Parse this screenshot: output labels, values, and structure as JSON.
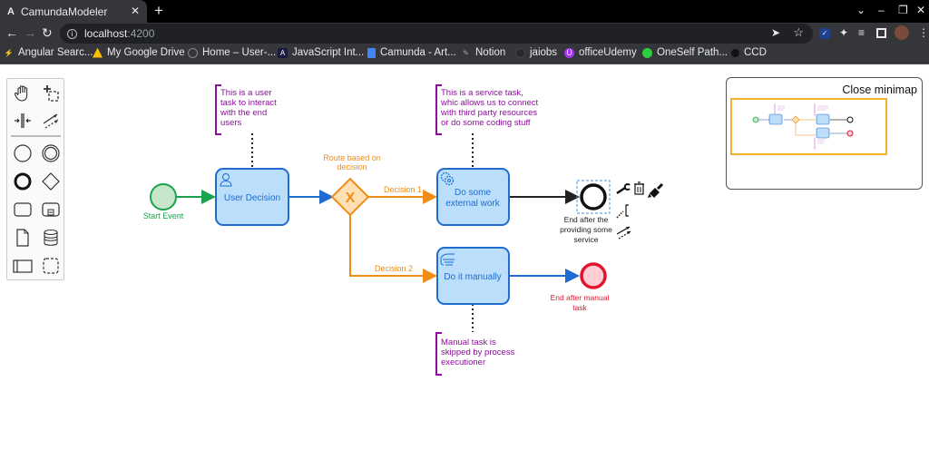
{
  "browser": {
    "tab_title": "CamundaModeler",
    "tab_favicon": "A",
    "new_tab_label": "+",
    "url_host": "localhost",
    "url_port": ":4200",
    "window_controls": [
      "⌄",
      "–",
      "❐",
      "✕"
    ]
  },
  "bookmarks": [
    {
      "label": "Angular Searc...",
      "icon": "lightning-icon",
      "color": "#4c8bf5"
    },
    {
      "label": "My Google Drive",
      "icon": "google-drive-icon",
      "color": "#fbbc04"
    },
    {
      "label": "Home – User-...",
      "icon": "globe-icon",
      "color": "#888888"
    },
    {
      "label": "JavaScript Int...",
      "icon": "angular-icon",
      "color": "#1a1a40"
    },
    {
      "label": "Camunda - Art...",
      "icon": "docs-icon",
      "color": "#4285f4"
    },
    {
      "label": "Notion",
      "icon": "paperclip-icon",
      "color": "#888888"
    },
    {
      "label": "jaiobs",
      "icon": "circle-icon",
      "color": "#333333"
    },
    {
      "label": "officeUdemy",
      "icon": "udemy-icon",
      "color": "#a435f0"
    },
    {
      "label": "OneSelf Path...",
      "icon": "green-dot-icon",
      "color": "#2ecc40"
    },
    {
      "label": "CCD",
      "icon": "dark-dot-icon",
      "color": "#111111"
    }
  ],
  "palette": {
    "tools": [
      "hand-tool",
      "lasso-tool",
      "space-tool",
      "global-connect-tool",
      "start-event",
      "intermediate-event",
      "end-event",
      "gateway",
      "task",
      "subprocess",
      "data-object",
      "data-store",
      "participant",
      "group"
    ]
  },
  "minimap": {
    "close_label": "Close minimap"
  },
  "diagram": {
    "colors": {
      "start": "#1aa34a",
      "task": "#1e6ccf",
      "task_fill": "#bbdefb",
      "gateway": "#f08c1a",
      "gateway_fill": "#ffe0b2",
      "end_red": "#e0152f",
      "end_red_fill": "#ffcdd2",
      "annotation": "#8e0c9e",
      "black": "#111111"
    },
    "start_event": {
      "label": "Start Event"
    },
    "user_task": {
      "label": "User Decision"
    },
    "gateway": {
      "label_line1": "Route based on",
      "label_line2": "decision",
      "marker": "X"
    },
    "flow_decision1": {
      "label": "Decision 1"
    },
    "flow_decision2": {
      "label": "Decision 2"
    },
    "service_task": {
      "label_line1": "Do some",
      "label_line2": "external work"
    },
    "manual_task": {
      "label": "Do it manually"
    },
    "end_service": {
      "label_line1": "End after the",
      "label_line2": "providing some",
      "label_line3": "service"
    },
    "end_manual": {
      "label_line1": "End after manual",
      "label_line2": "task"
    },
    "annotation_user": {
      "lines": [
        "This is a user",
        "task to interact",
        "with the end",
        "users"
      ]
    },
    "annotation_service": {
      "lines": [
        "This is a service task,",
        "whic allows us to connect",
        "with third party resources",
        "or do some coding stuff"
      ]
    },
    "annotation_manual": {
      "lines": [
        "Manual task is",
        "skipped by process",
        "executioner"
      ]
    }
  },
  "context_pad": [
    "wrench-icon",
    "trash-icon",
    "color-brush-icon",
    "annotation-icon",
    "connect-icon"
  ]
}
